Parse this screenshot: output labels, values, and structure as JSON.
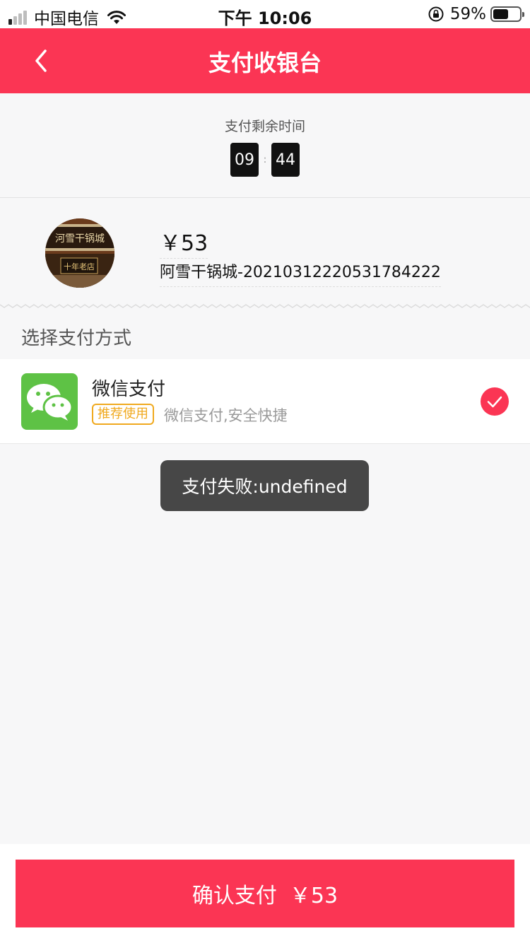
{
  "status_bar": {
    "carrier": "中国电信",
    "time": "下午 10:06",
    "battery_percent": "59%",
    "battery_level": 0.59,
    "signal_bars_active": 1
  },
  "nav": {
    "title": "支付收银台",
    "back_icon": "chevron-left-icon"
  },
  "timer": {
    "label": "支付剩余时间",
    "minutes": "09",
    "separator": ":",
    "seconds": "44"
  },
  "order": {
    "amount": "￥53",
    "name": "阿雪干锅城-20210312220531784222"
  },
  "payment": {
    "section_title": "选择支付方式",
    "method": {
      "name": "微信支付",
      "badge": "推荐使用",
      "description": "微信支付,安全快捷",
      "selected": true,
      "icon": "wechat-icon"
    }
  },
  "toast": {
    "message": "支付失败:undefined"
  },
  "confirm": {
    "label": "确认支付",
    "amount": "￥53"
  },
  "colors": {
    "primary": "#fb3554",
    "wechat_green": "#5ec245",
    "badge_orange": "#f0a91e",
    "toast_bg": "#474747"
  }
}
